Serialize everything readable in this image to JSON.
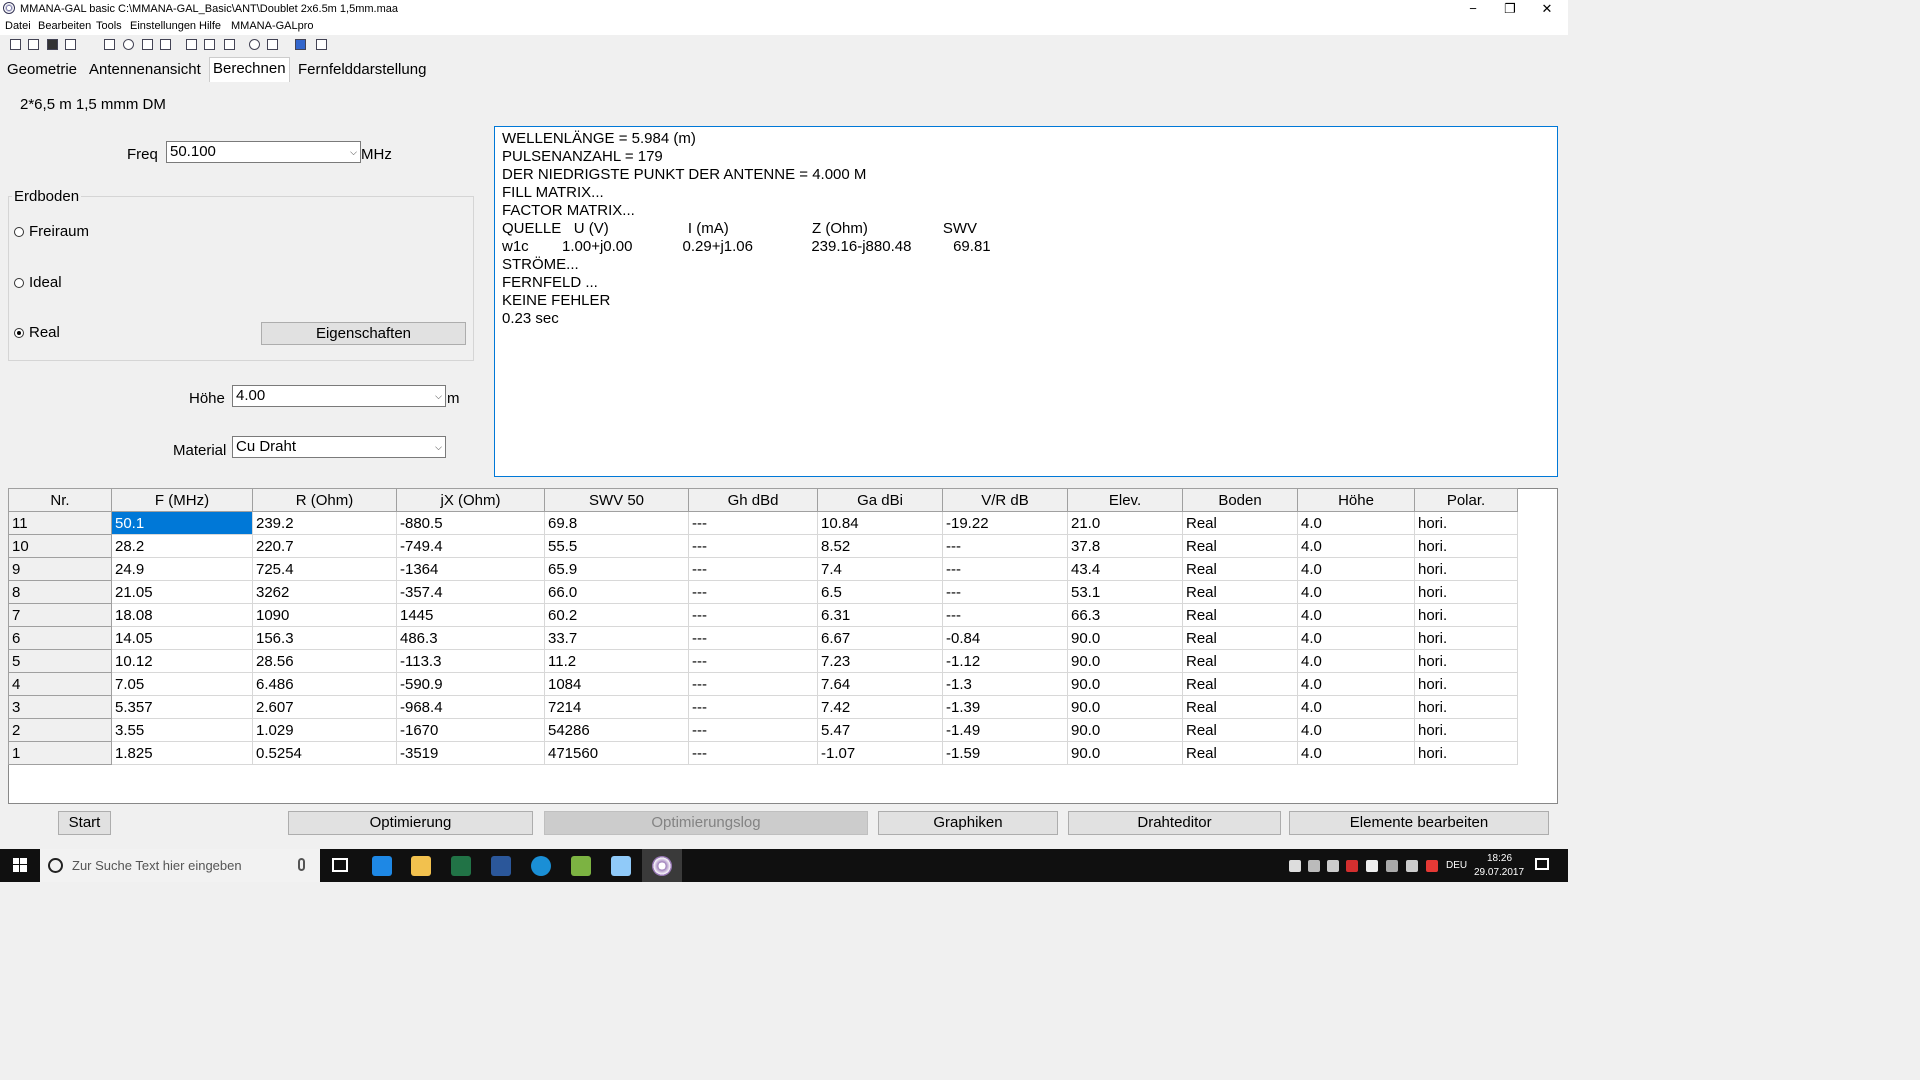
{
  "window": {
    "title": "MMANA-GAL basic C:\\MMANA-GAL_Basic\\ANT\\Doublet 2x6.5m 1,5mm.maa",
    "controls": [
      "−",
      "❐",
      "✕"
    ]
  },
  "menu": [
    "Datei",
    "Bearbeiten",
    "Tools",
    "Einstellungen",
    "Hilfe",
    "MMANA-GALpro"
  ],
  "tabs": [
    "Geometrie",
    "Antennenansicht",
    "Berechnen",
    "Fernfelddarstellung"
  ],
  "antenna_name": "2*6,5 m 1,5 mmm DM",
  "freq": {
    "label": "Freq",
    "value": "50.100",
    "unit": "MHz"
  },
  "ground": {
    "group_label": "Erdboden",
    "options": [
      "Freiraum",
      "Ideal",
      "Real"
    ],
    "selected": "Real",
    "properties_button": "Eigenschaften"
  },
  "height": {
    "label": "Höhe",
    "value": "4.00",
    "unit": "m"
  },
  "material": {
    "label": "Material",
    "value": "Cu Draht"
  },
  "output_lines": [
    "WELLENLÄNGE = 5.984 (m)",
    "PULSENANZAHL = 179",
    "DER NIEDRIGSTE PUNKT DER ANTENNE = 4.000 M",
    "FILL MATRIX...",
    "FACTOR MATRIX...",
    "QUELLE   U (V)                   I (mA)                    Z (Ohm)                  SWV",
    "w1c        1.00+j0.00            0.29+j1.06              239.16-j880.48          69.81",
    "STRÖME...",
    "FERNFELD ...",
    "KEINE FEHLER",
    "0.23 sec"
  ],
  "table": {
    "headers": [
      "Nr.",
      "F (MHz)",
      "R (Ohm)",
      "jX (Ohm)",
      "SWV 50",
      "Gh dBd",
      "Ga dBi",
      "V/R dB",
      "Elev.",
      "Boden",
      "Höhe",
      "Polar."
    ],
    "rows": [
      [
        "11",
        "50.1",
        "239.2",
        "-880.5",
        "69.8",
        "---",
        "10.84",
        "-19.22",
        "21.0",
        "Real",
        "4.0",
        "hori."
      ],
      [
        "10",
        "28.2",
        "220.7",
        "-749.4",
        "55.5",
        "---",
        "8.52",
        " ---",
        "37.8",
        "Real",
        "4.0",
        "hori."
      ],
      [
        "9",
        "24.9",
        "725.4",
        "-1364",
        "65.9",
        "---",
        "7.4",
        " ---",
        "43.4",
        "Real",
        "4.0",
        "hori."
      ],
      [
        "8",
        "21.05",
        "3262",
        "-357.4",
        "66.0",
        "---",
        "6.5",
        " ---",
        "53.1",
        "Real",
        "4.0",
        "hori."
      ],
      [
        "7",
        "18.08",
        "1090",
        "1445",
        "60.2",
        "---",
        "6.31",
        " ---",
        "66.3",
        "Real",
        "4.0",
        "hori."
      ],
      [
        "6",
        "14.05",
        "156.3",
        "486.3",
        "33.7",
        "---",
        "6.67",
        "-0.84",
        "90.0",
        "Real",
        "4.0",
        "hori."
      ],
      [
        "5",
        "10.12",
        "28.56",
        "-113.3",
        "11.2",
        "---",
        "7.23",
        "-1.12",
        "90.0",
        "Real",
        "4.0",
        "hori."
      ],
      [
        "4",
        "7.05",
        "6.486",
        "-590.9",
        "1084",
        "---",
        "7.64",
        "-1.3",
        "90.0",
        "Real",
        "4.0",
        "hori."
      ],
      [
        "3",
        "5.357",
        "2.607",
        "-968.4",
        "7214",
        "---",
        "7.42",
        "-1.39",
        "90.0",
        "Real",
        "4.0",
        "hori."
      ],
      [
        "2",
        "3.55",
        "1.029",
        "-1670",
        "54286",
        "---",
        "5.47",
        "-1.49",
        "90.0",
        "Real",
        "4.0",
        "hori."
      ],
      [
        "1",
        "1.825",
        "0.5254",
        "-3519",
        "471560",
        "---",
        "-1.07",
        "-1.59",
        "90.0",
        "Real",
        "4.0",
        "hori."
      ]
    ]
  },
  "buttons": {
    "start": "Start",
    "optimierung": "Optimierung",
    "optimierungslog": "Optimierungslog",
    "graphiken": "Graphiken",
    "drahteditor": "Drahteditor",
    "elemente": "Elemente bearbeiten"
  },
  "taskbar": {
    "search_placeholder": "Zur Suche Text hier eingeben",
    "language": "DEU",
    "time": "18:26",
    "date": "29.07.2017"
  }
}
